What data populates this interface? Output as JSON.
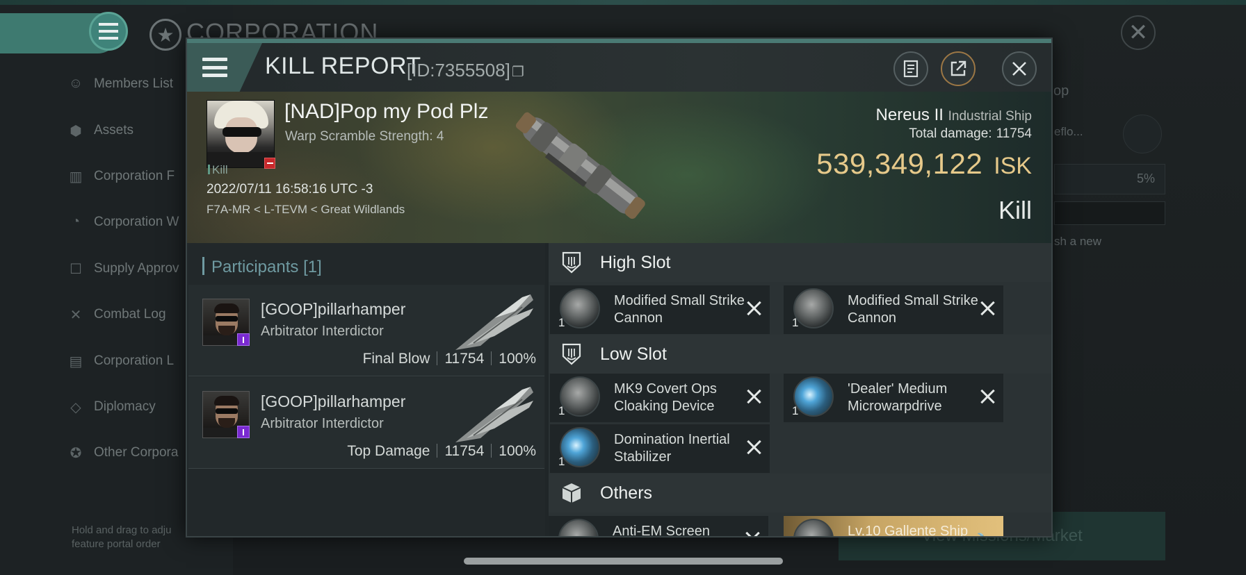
{
  "background": {
    "title": "CORPORATION",
    "sidebar_items": [
      {
        "label": "Members List",
        "icon": "members-icon"
      },
      {
        "label": "Assets",
        "icon": "assets-icon"
      },
      {
        "label": "Corporation F",
        "icon": "chart-icon"
      },
      {
        "label": "Corporation W",
        "icon": "pie-icon"
      },
      {
        "label": "Supply Approv",
        "icon": "supply-icon"
      },
      {
        "label": "Combat Log",
        "icon": "swords-icon"
      },
      {
        "label": "Corporation L",
        "icon": "log-icon"
      },
      {
        "label": "Diplomacy",
        "icon": "handshake-icon"
      },
      {
        "label": "Other Corpora",
        "icon": "star-icon"
      }
    ],
    "hint": "Hold and drag to adju feature portal order",
    "right_fragments": {
      "pop": "op",
      "reflo": "eflo...",
      "percent": "5%",
      "new": "sh a new"
    },
    "market_button": "View Missions/Market"
  },
  "modal": {
    "title": "KILL REPORT",
    "id_text": "[ID:7355508]",
    "victim": {
      "name": "[NAD]Pop my Pod Plz",
      "scram": "Warp Scramble Strength: 4",
      "tag": "Kill",
      "time": "2022/07/11 16:58:16 UTC -3",
      "location": "F7A-MR < L-TEVM < Great Wildlands"
    },
    "ship": {
      "name": "Nereus II",
      "class": "Industrial Ship",
      "damage_label": "Total damage:",
      "damage_value": "11754",
      "isk_value": "539,349,122",
      "isk_unit": "ISK",
      "result": "Kill"
    },
    "participants": {
      "label": "Participants",
      "count": "[1]",
      "rows": [
        {
          "name": "[GOOP]pillarhamper",
          "ship": "Arbitrator Interdictor",
          "role": "Final Blow",
          "damage": "11754",
          "percent": "100%"
        },
        {
          "name": "[GOOP]pillarhamper",
          "ship": "Arbitrator Interdictor",
          "role": "Top Damage",
          "damage": "11754",
          "percent": "100%"
        }
      ]
    },
    "fitting": {
      "high_label": "High Slot",
      "low_label": "Low Slot",
      "others_label": "Others",
      "high": [
        {
          "name": "Modified Small Strike Cannon",
          "qty": "1"
        },
        {
          "name": "Modified Small Strike Cannon",
          "qty": "1"
        }
      ],
      "low": [
        {
          "name": "MK9 Covert Ops Cloaking Device",
          "qty": "1"
        },
        {
          "name": "'Dealer' Medium Microwarpdrive",
          "qty": "1"
        },
        {
          "name": "Domination Inertial Stabilizer",
          "qty": "1"
        }
      ],
      "others": [
        {
          "name": "Anti-EM Screen"
        },
        {
          "name": "Lv.10 Gallente Ship"
        }
      ]
    }
  }
}
